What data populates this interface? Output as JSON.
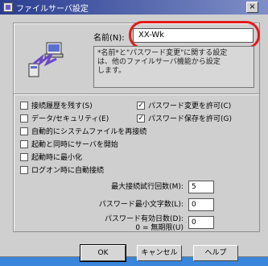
{
  "window": {
    "title": "ファイルサーバ設定",
    "close_glyph": "×"
  },
  "server": {
    "name_label": "名前(N):",
    "name_value": "XX-Wk",
    "description": "*名前*と\"パスワード変更\"に関する設定\nは、他のファイルサーバ機能から設定\nします。"
  },
  "options": {
    "left": [
      {
        "label": "接続履歴を残す(S)",
        "checked": false
      },
      {
        "label": "データ/セキュリティ(E)",
        "checked": false
      },
      {
        "label": "自動的にシステムファイルを再接続",
        "checked": false
      },
      {
        "label": "起動と同時にサーバを開始",
        "checked": false
      },
      {
        "label": "起動時に最小化",
        "checked": false
      },
      {
        "label": "ログオン時に自動接続",
        "checked": false
      }
    ],
    "right": [
      {
        "label": "パスワード変更を許可(C)",
        "checked": true,
        "mark": "✓"
      },
      {
        "label": "パスワード保存を許可(G)",
        "checked": true,
        "mark": "✓"
      }
    ]
  },
  "numeric": [
    {
      "label": "最大接続試行回数(M):",
      "value": "5"
    },
    {
      "label": "パスワード最小文字数(L):",
      "value": "0"
    },
    {
      "label": "パスワード有効日数(D):\n0 = 無期限(U)",
      "value": "0"
    }
  ],
  "buttons": {
    "ok": "OK",
    "cancel": "キャンセル",
    "help": "ヘルプ"
  }
}
